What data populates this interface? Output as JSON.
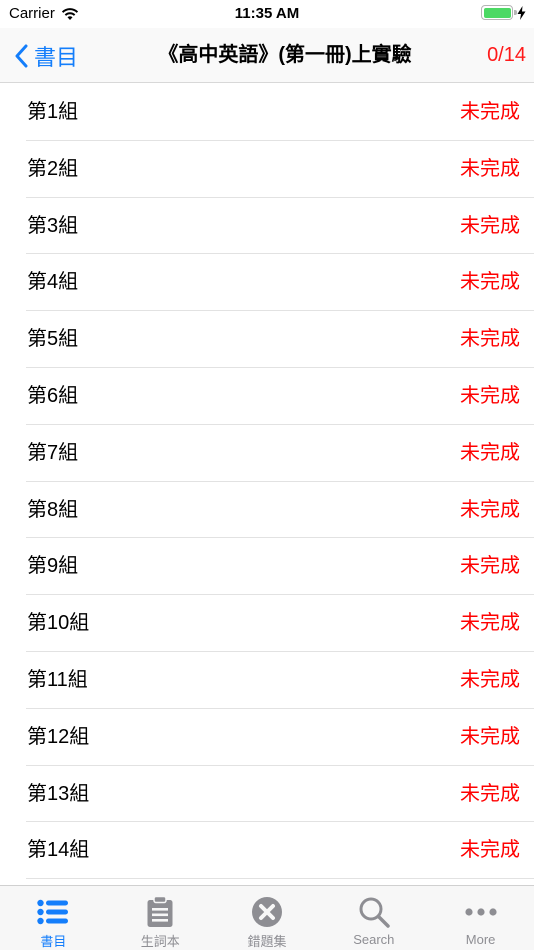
{
  "status_bar": {
    "carrier": "Carrier",
    "time": "11:35 AM"
  },
  "nav": {
    "back_label": "書目",
    "title": "《高中英語》(第一冊)上實驗",
    "progress": "0/14"
  },
  "list": {
    "items": [
      {
        "label": "第1組",
        "status": "未完成"
      },
      {
        "label": "第2組",
        "status": "未完成"
      },
      {
        "label": "第3組",
        "status": "未完成"
      },
      {
        "label": "第4組",
        "status": "未完成"
      },
      {
        "label": "第5組",
        "status": "未完成"
      },
      {
        "label": "第6組",
        "status": "未完成"
      },
      {
        "label": "第7組",
        "status": "未完成"
      },
      {
        "label": "第8組",
        "status": "未完成"
      },
      {
        "label": "第9組",
        "status": "未完成"
      },
      {
        "label": "第10組",
        "status": "未完成"
      },
      {
        "label": "第11組",
        "status": "未完成"
      },
      {
        "label": "第12組",
        "status": "未完成"
      },
      {
        "label": "第13組",
        "status": "未完成"
      },
      {
        "label": "第14組",
        "status": "未完成"
      }
    ]
  },
  "tab_bar": {
    "tabs": [
      {
        "label": "書目",
        "icon": "list-icon",
        "active": true
      },
      {
        "label": "生詞本",
        "icon": "clipboard-icon",
        "active": false
      },
      {
        "label": "錯題集",
        "icon": "x-circle-icon",
        "active": false
      },
      {
        "label": "Search",
        "icon": "search-icon",
        "active": false
      },
      {
        "label": "More",
        "icon": "more-icon",
        "active": false
      }
    ]
  },
  "colors": {
    "accent": "#147efb",
    "incomplete": "#ff0000",
    "inactive_tab": "#8e8e93",
    "battery": "#4cd964"
  }
}
